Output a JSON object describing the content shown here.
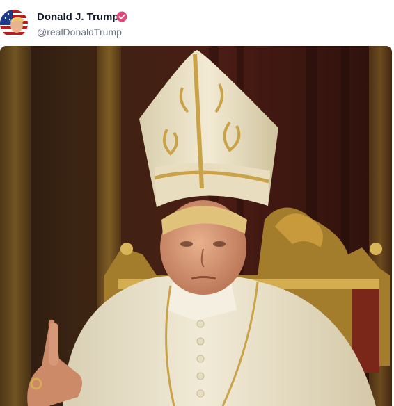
{
  "post": {
    "author": {
      "display_name": "Donald J. Trump",
      "handle": "@realDonaldTrump",
      "verified": true,
      "avatar_icon": "avatar-icon",
      "verified_icon": "verified-badge-icon"
    },
    "media": {
      "type": "image",
      "subject_icon": "portrait-image"
    }
  },
  "colors": {
    "verified_badge": "#e0487a",
    "name_text": "#111827",
    "handle_text": "#6b7280",
    "robe": "#ece5cf",
    "gold": "#c9a24a",
    "background_curtain": "#3a1712"
  }
}
